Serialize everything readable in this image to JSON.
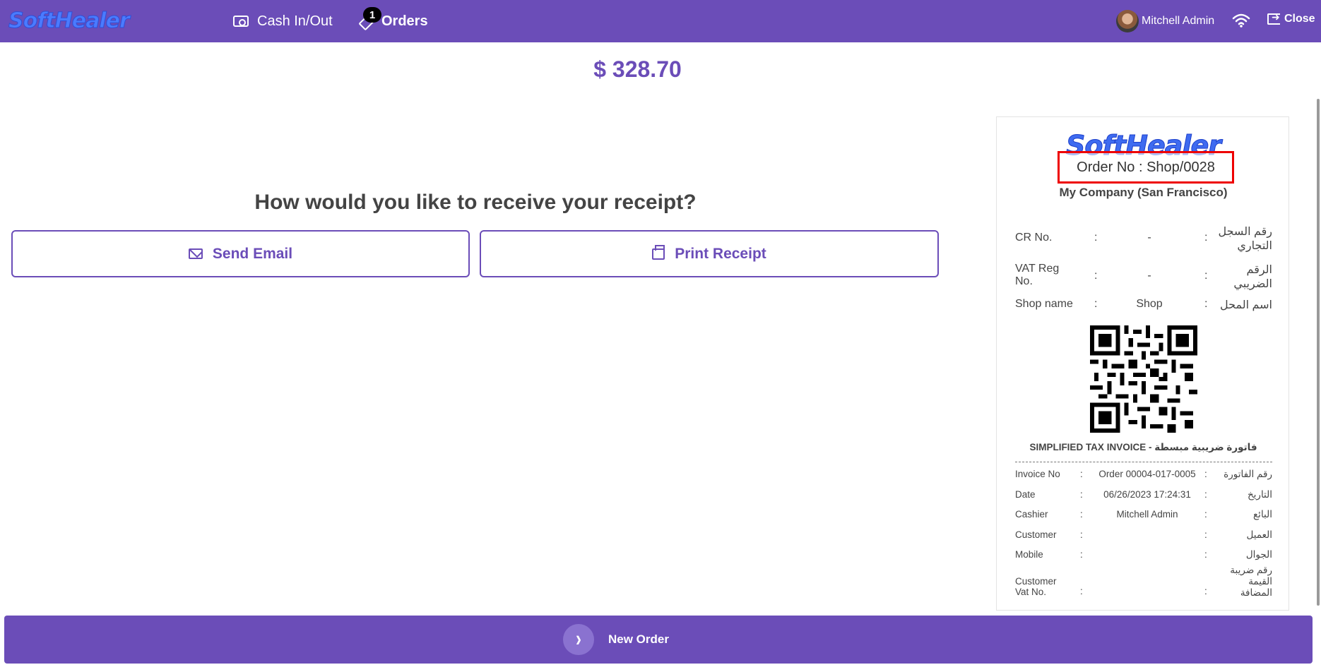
{
  "topbar": {
    "logo_text": "SoftHealer",
    "nav": {
      "cash_label": "Cash In/Out",
      "orders_label": "Orders",
      "orders_badge": "1"
    },
    "user_name": "Mitchell Admin",
    "close_label": "Close"
  },
  "amount": "$ 328.70",
  "receipt_prompt": {
    "question": "How would you like to receive your receipt?",
    "send_email_label": "Send Email",
    "print_label": "Print Receipt"
  },
  "receipt": {
    "logo_text": "SoftHealer",
    "order_no": "Order No : Shop/0028",
    "company": "My Company (San Francisco)",
    "info": [
      {
        "label": "CR No.",
        "value": "-",
        "arabic": "رقم السجل التجاري"
      },
      {
        "label": "VAT Reg No.",
        "value": "-",
        "arabic": "الرقم الضريبي"
      },
      {
        "label": "Shop name",
        "value": "Shop",
        "arabic": "اسم المحل"
      }
    ],
    "tax_title": "SIMPLIFIED TAX INVOICE - فاتورة ضريبية مبسطة",
    "details": [
      {
        "label": "Invoice No",
        "value": "Order 00004-017-0005",
        "arabic": "رقم الفاتورة"
      },
      {
        "label": "Date",
        "value": "06/26/2023 17:24:31",
        "arabic": "التاريخ"
      },
      {
        "label": "Cashier",
        "value": "Mitchell Admin",
        "arabic": "البائع"
      },
      {
        "label": "Customer",
        "value": "",
        "arabic": "العميل"
      },
      {
        "label": "Mobile",
        "value": "",
        "arabic": "الجوال"
      },
      {
        "label": "Customer Vat No.",
        "value": "",
        "arabic": "رقم ضريبة القيمة المضافة"
      }
    ],
    "separator": ":"
  },
  "footer": {
    "new_order_label": "New Order"
  },
  "colors": {
    "brand": "#6b4db8",
    "highlight": "#ee0000",
    "logo_blue": "#3e6bf0"
  }
}
